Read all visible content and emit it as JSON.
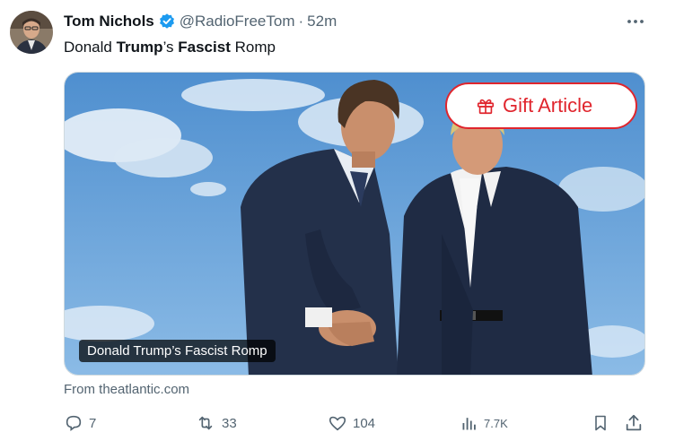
{
  "author": {
    "name": "Tom Nichols",
    "handle": "@RadioFreeTom",
    "separator": "·",
    "time": "52m"
  },
  "tweet": {
    "text_parts": [
      "Donald ",
      "Trump",
      "’s ",
      "Fascist",
      " Romp"
    ]
  },
  "card": {
    "gift_label": "Gift Article",
    "caption": "Donald Trump’s Fascist Romp",
    "source": "From theatlantic.com"
  },
  "actions": {
    "replies": "7",
    "reposts": "33",
    "likes": "104",
    "views": "7.7K"
  },
  "icons": {
    "verified": "verified-badge-icon",
    "more": "more-dots-icon",
    "gift": "gift-icon",
    "reply": "reply-icon",
    "repost": "repost-icon",
    "like": "heart-icon",
    "views": "views-chart-icon",
    "bookmark": "bookmark-icon",
    "share": "share-icon"
  },
  "colors": {
    "brand_blue": "#1d9bf0",
    "gift_red": "#e0252d",
    "secondary_text": "#536471"
  }
}
